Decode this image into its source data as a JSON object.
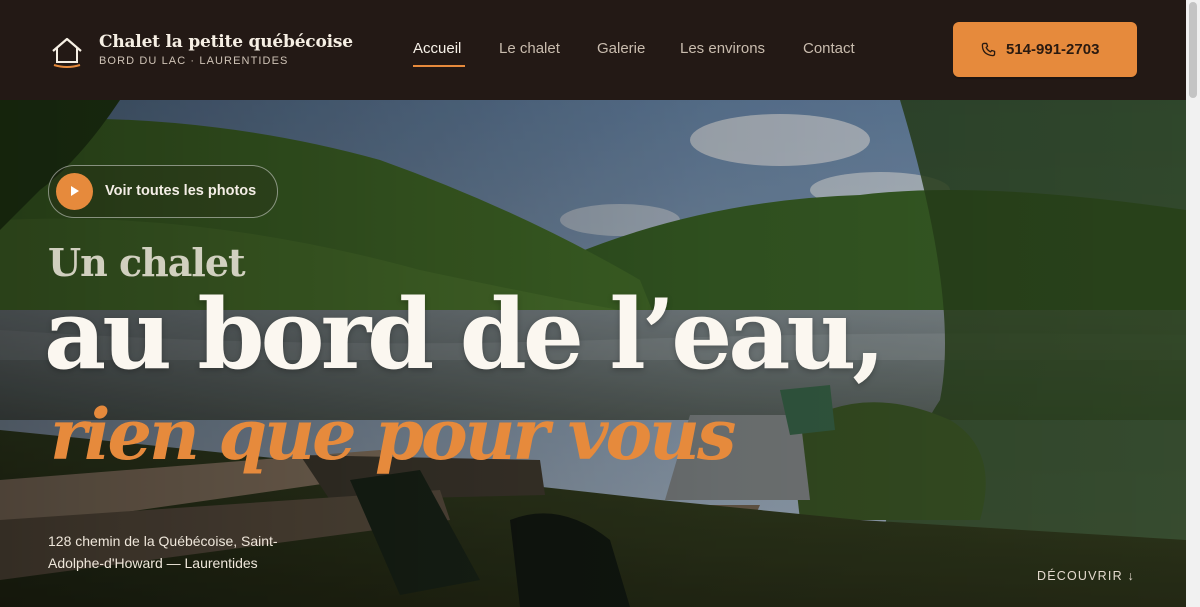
{
  "brand": {
    "title": "Chalet la petite québécoise",
    "subtitle": "BORD DU LAC · LAURENTIDES",
    "logo_icon": "house-icon"
  },
  "nav": {
    "items": [
      {
        "label": "Accueil",
        "active": true
      },
      {
        "label": "Le chalet",
        "active": false
      },
      {
        "label": "Galerie",
        "active": false
      },
      {
        "label": "Les environs",
        "active": false
      },
      {
        "label": "Contact",
        "active": false
      }
    ]
  },
  "call_button": {
    "label": "514-991-2703",
    "icon": "phone-icon"
  },
  "hero": {
    "photos_button": "Voir toutes les photos",
    "photos_icon": "play-icon",
    "heading_line1": "Un chalet",
    "heading_line2": "au bord de l’eau,",
    "heading_line3": "rien que pour vous",
    "address": "128 chemin de la Québécoise, Saint-Adolphe-d'Howard — Laurentides",
    "discover": "DÉCOUVRIR ↓"
  },
  "colors": {
    "header_bg": "#231915",
    "accent": "#e68a3c",
    "light_text": "#fbf7f0"
  }
}
